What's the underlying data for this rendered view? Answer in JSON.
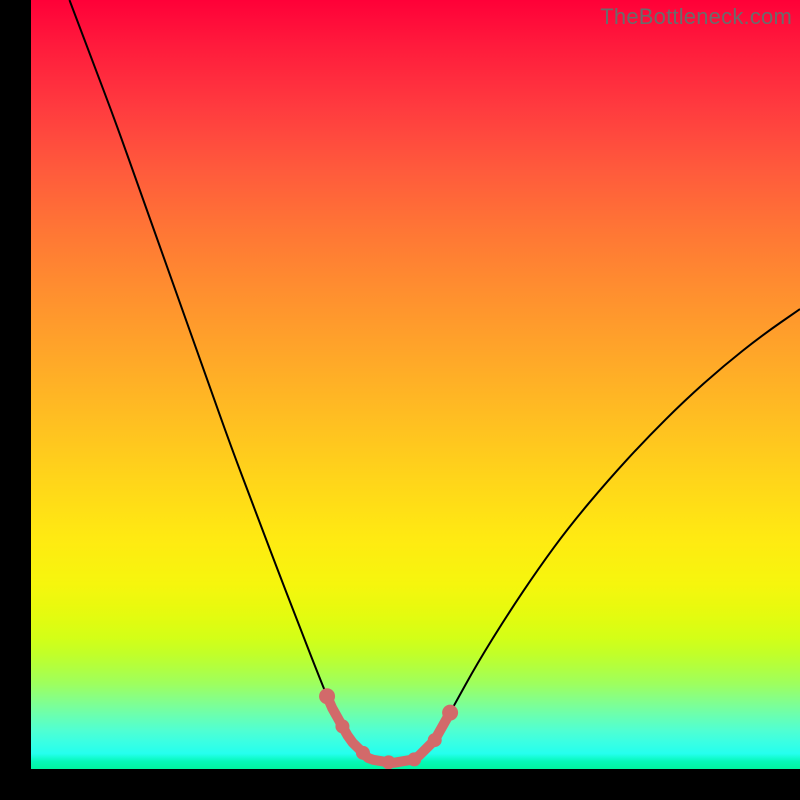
{
  "watermark": "TheBottleneck.com",
  "chart_data": {
    "type": "line",
    "title": "",
    "xlabel": "",
    "ylabel": "",
    "xlim": [
      0,
      100
    ],
    "ylim": [
      0,
      100
    ],
    "curve_points_pct": [
      {
        "x": 5.0,
        "y": 100.0
      },
      {
        "x": 8.0,
        "y": 92.0
      },
      {
        "x": 11.0,
        "y": 84.0
      },
      {
        "x": 14.0,
        "y": 75.5
      },
      {
        "x": 17.0,
        "y": 67.0
      },
      {
        "x": 20.0,
        "y": 58.5
      },
      {
        "x": 23.0,
        "y": 50.0
      },
      {
        "x": 26.0,
        "y": 41.5
      },
      {
        "x": 29.0,
        "y": 33.5
      },
      {
        "x": 32.0,
        "y": 25.5
      },
      {
        "x": 34.5,
        "y": 19.0
      },
      {
        "x": 37.0,
        "y": 12.5
      },
      {
        "x": 39.0,
        "y": 7.5
      },
      {
        "x": 41.5,
        "y": 3.0
      },
      {
        "x": 44.0,
        "y": 0.5
      },
      {
        "x": 47.0,
        "y": 0.0
      },
      {
        "x": 50.0,
        "y": 0.5
      },
      {
        "x": 52.5,
        "y": 3.0
      },
      {
        "x": 55.0,
        "y": 7.5
      },
      {
        "x": 58.0,
        "y": 13.0
      },
      {
        "x": 62.0,
        "y": 19.5
      },
      {
        "x": 66.0,
        "y": 25.5
      },
      {
        "x": 70.0,
        "y": 31.0
      },
      {
        "x": 75.0,
        "y": 37.0
      },
      {
        "x": 80.0,
        "y": 42.5
      },
      {
        "x": 85.0,
        "y": 47.5
      },
      {
        "x": 90.0,
        "y": 52.0
      },
      {
        "x": 95.0,
        "y": 56.0
      },
      {
        "x": 100.0,
        "y": 59.5
      }
    ],
    "accent": {
      "color": "#d26a6a",
      "range_x_pct": [
        38.5,
        54.5
      ],
      "dot_radius_px": 7,
      "stroke_width_px": 10
    }
  }
}
